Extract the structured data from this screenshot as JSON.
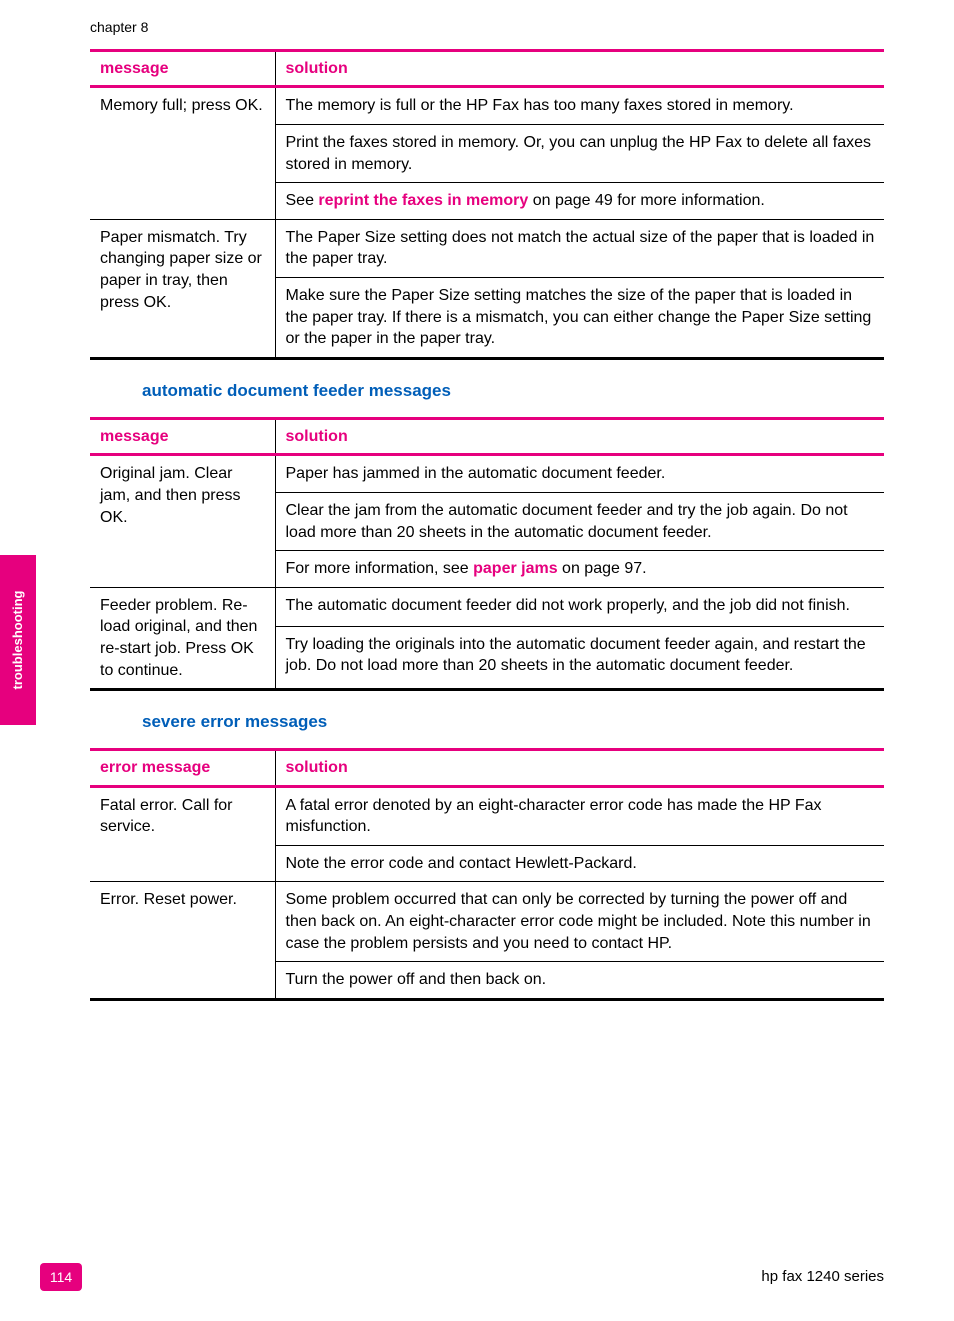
{
  "chapter": "chapter 8",
  "side_tab": "troubleshooting",
  "table1": {
    "headers": {
      "msg": "message",
      "sol": "solution"
    },
    "rows": [
      {
        "msg": "Memory full; press OK.",
        "sol": {
          "p1": "The memory is full or the HP Fax has too many faxes stored in memory.",
          "p2": "Print the faxes stored in memory. Or, you can unplug the HP Fax to delete all faxes stored in memory.",
          "p3a": "See ",
          "p3link": "reprint the faxes in memory",
          "p3b": " on page 49 for more information."
        }
      },
      {
        "msg": "Paper mismatch. Try changing paper size or paper in tray, then press OK.",
        "sol": {
          "p1": "The Paper Size setting does not match the actual size of the paper that is loaded in the paper tray.",
          "p2": "Make sure the Paper Size setting matches the size of the paper that is loaded in the paper tray. If there is a mismatch, you can either change the Paper Size setting or the paper in the paper tray."
        }
      }
    ]
  },
  "sec2_title": "automatic document feeder messages",
  "table2": {
    "headers": {
      "msg": "message",
      "sol": "solution"
    },
    "rows": [
      {
        "msg": "Original jam. Clear jam, and then press OK.",
        "sol": {
          "p1": "Paper has jammed in the automatic document feeder.",
          "p2": "Clear the jam from the automatic document feeder and try the job again. Do not load more than 20 sheets in the automatic document feeder.",
          "p3a": "For more information, see ",
          "p3link": "paper jams",
          "p3b": " on page 97."
        }
      },
      {
        "msg": "Feeder problem. Re-load original, and then re-start job. Press OK to continue.",
        "sol": {
          "p1": "The automatic document feeder did not work properly, and the job did not finish.",
          "p2": "Try loading the originals into the automatic document feeder again, and restart the job. Do not load more than 20 sheets in the automatic document feeder."
        }
      }
    ]
  },
  "sec3_title": "severe error messages",
  "table3": {
    "headers": {
      "msg": "error message",
      "sol": "solution"
    },
    "rows": [
      {
        "msg": "Fatal error. Call for service.",
        "sol": {
          "p1": "A fatal error denoted by an eight-character error code has made the HP Fax misfunction.",
          "p2": "Note the error code and contact Hewlett-Packard."
        }
      },
      {
        "msg": "Error. Reset power.",
        "sol": {
          "p1": "Some problem occurred that can only be corrected by turning the power off and then back on. An eight-character error code might be included. Note this number in case the problem persists and you need to contact HP.",
          "p2": "Turn the power off and then back on."
        }
      }
    ]
  },
  "footer": {
    "page": "114",
    "device": "hp fax 1240 series"
  }
}
